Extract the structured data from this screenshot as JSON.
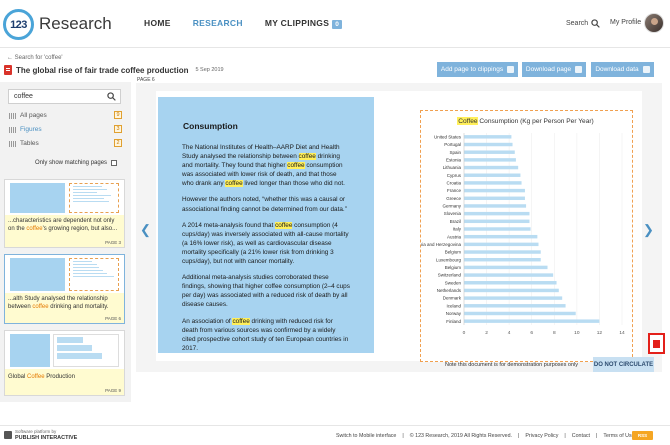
{
  "header": {
    "logo_number": "123",
    "logo_text": "Research",
    "nav": [
      {
        "label": "HOME"
      },
      {
        "label": "RESEARCH"
      },
      {
        "label": "MY CLIPPINGS",
        "badge": "0"
      }
    ],
    "search_label": "Search",
    "profile_label": "My Profile"
  },
  "subheader": {
    "back_label": "Search for 'coffee'",
    "doc_title": "The global rise of fair trade coffee production",
    "doc_date": "5 Sep 2019",
    "page_label": "PAGE 6",
    "buttons": {
      "add_clip": "Add page to clippings",
      "download_page": "Download page",
      "download_data": "Download data"
    }
  },
  "sidebar": {
    "search_value": "coffee",
    "filters": [
      {
        "label": "All pages",
        "count": "9"
      },
      {
        "label": "Figures",
        "count": "3"
      },
      {
        "label": "Tables",
        "count": "2"
      }
    ],
    "matching_label": "Only show matching pages",
    "thumbs": [
      {
        "pre": "...characteristics are dependent not only on the ",
        "hl": "coffee",
        "post": "'s growing region, but also...",
        "page": "PAGE 3"
      },
      {
        "pre": "...alth Study analysed the relationship between ",
        "hl": "coffee",
        "post": " drinking and mortality.",
        "page": "PAGE 6"
      },
      {
        "pre": "Global ",
        "hl": "Coffee",
        "post": " Production",
        "page": "PAGE 9"
      }
    ]
  },
  "article": {
    "heading": "Consumption",
    "p1": {
      "a": "The National Institutes of Health–AARP Diet and Health Study analysed the relationship between ",
      "h1": "coffee",
      "b": " drinking and mortality. They found that higher ",
      "h2": "coffee",
      "c": " consumption was associated with lower risk of death, and that those who drank any ",
      "h3": "coffee",
      "d": " lived longer than those who did not."
    },
    "p2": "However the authors noted, “whether this was a causal or associational finding cannot be determined from our data.”",
    "p3": {
      "a": "A 2014 meta-analysis found that ",
      "h1": "coffee",
      "b": " consumption (4 cups/day) was inversely associated with all-cause mortality (a 16% lower risk), as well as cardiovascular disease mortality specifically (a 21% lower risk from drinking 3 cups/day), but not with cancer mortality."
    },
    "p4": "Additional meta-analysis studies corroborated these findings, showing that higher coffee consumption (2–4 cups per day) was associated with a reduced risk of death by all disease causes.",
    "p5": {
      "a": "An association of ",
      "h1": "coffee",
      "b": " drinking with reduced risk for death from various sources was confirmed by a widely cited prospective cohort study of ten European countries in 2017."
    }
  },
  "chart_data": {
    "type": "bar",
    "orientation": "horizontal",
    "title_hl": "Coffee",
    "title_rest": " Consumption (Kg per Person Per Year)",
    "categories": [
      "United States",
      "Portugal",
      "Spain",
      "Estonia",
      "Lithuania",
      "Cyprus",
      "Croatia",
      "France",
      "Greece",
      "Germany",
      "Slovenia",
      "Brazil",
      "Italy",
      "Austria",
      "Bosnia and Herzegovina",
      "Belgium",
      "Luxembourg",
      "Belgium",
      "Switzerland",
      "Sweden",
      "Netherlands",
      "Denmark",
      "Iceland",
      "Norway",
      "Finland"
    ],
    "values": [
      4.2,
      4.3,
      4.5,
      4.6,
      4.8,
      5.0,
      5.1,
      5.4,
      5.4,
      5.5,
      5.8,
      5.8,
      5.9,
      6.5,
      6.6,
      6.8,
      6.8,
      7.4,
      7.9,
      8.2,
      8.4,
      8.7,
      9.0,
      9.9,
      12.0
    ],
    "xticks": [
      "0",
      "2",
      "4",
      "6",
      "8",
      "10",
      "12",
      "14"
    ],
    "xlim": [
      0,
      14
    ],
    "bar_color": "#b9dcf2"
  },
  "footer": {
    "platform_small": "Software platform by",
    "platform_name": "PUBLISH INTERACTIVE",
    "links": [
      "Switch to Mobile interface",
      "|",
      "© 123 Research, 2019 All Rights Reserved.",
      "|",
      "Privacy Policy",
      "|",
      "Contact",
      "|",
      "Terms of Use"
    ],
    "rss": "RSS"
  },
  "notice": {
    "note": "Note this document is for demonstration purposes only",
    "circ": "DO NOT CIRCULATE"
  }
}
